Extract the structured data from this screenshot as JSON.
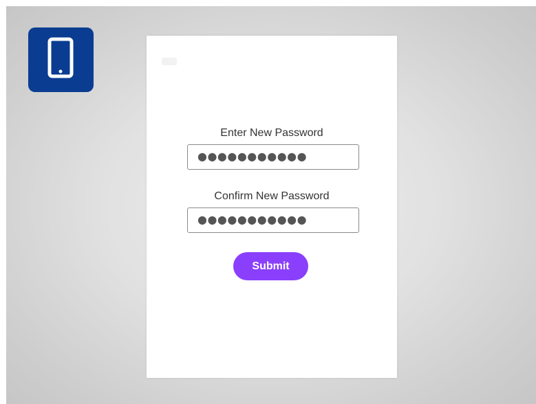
{
  "form": {
    "new_password_label": "Enter New Password",
    "new_password_value": "●●●●●●●●●●●",
    "confirm_password_label": "Confirm New Password",
    "confirm_password_value": "●●●●●●●●●●●",
    "submit_label": "Submit"
  },
  "colors": {
    "badge_background": "#0a3d91",
    "submit_background": "#8a3ffc",
    "card_background": "#ffffff"
  },
  "icons": {
    "badge_icon": "smartphone-icon"
  }
}
